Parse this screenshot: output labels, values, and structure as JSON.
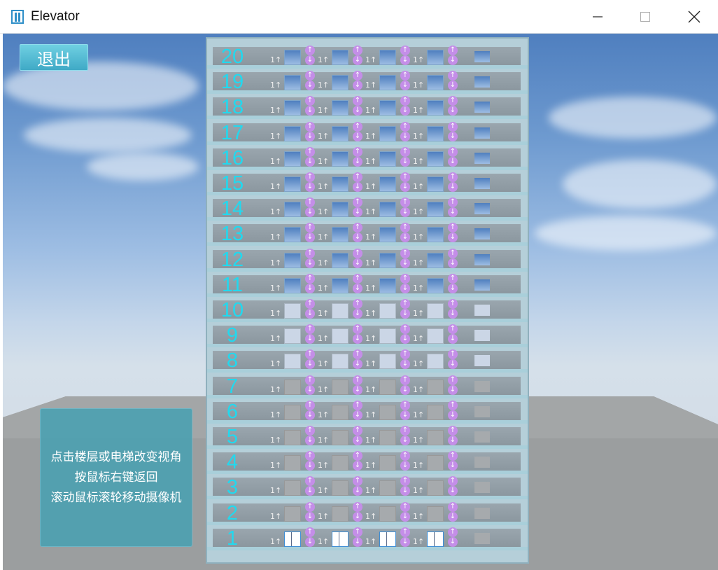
{
  "window": {
    "title": "Elevator"
  },
  "controls": {
    "exit_label": "退出"
  },
  "info": {
    "lines": [
      "点击楼层或电梯改变视角",
      "按鼠标右键返回",
      "滚动鼠标滚轮移动摄像机"
    ]
  },
  "building": {
    "floors": [
      "20",
      "19",
      "18",
      "17",
      "16",
      "15",
      "14",
      "13",
      "12",
      "11",
      "10",
      "9",
      "8",
      "7",
      "6",
      "5",
      "4",
      "3",
      "2",
      "1"
    ],
    "elevator_count": 4,
    "car_location_display": "1↑",
    "cars_at_floor": "1",
    "colors": {
      "floor_number": "#21d9ef",
      "call_button": "#c48ee8"
    }
  }
}
